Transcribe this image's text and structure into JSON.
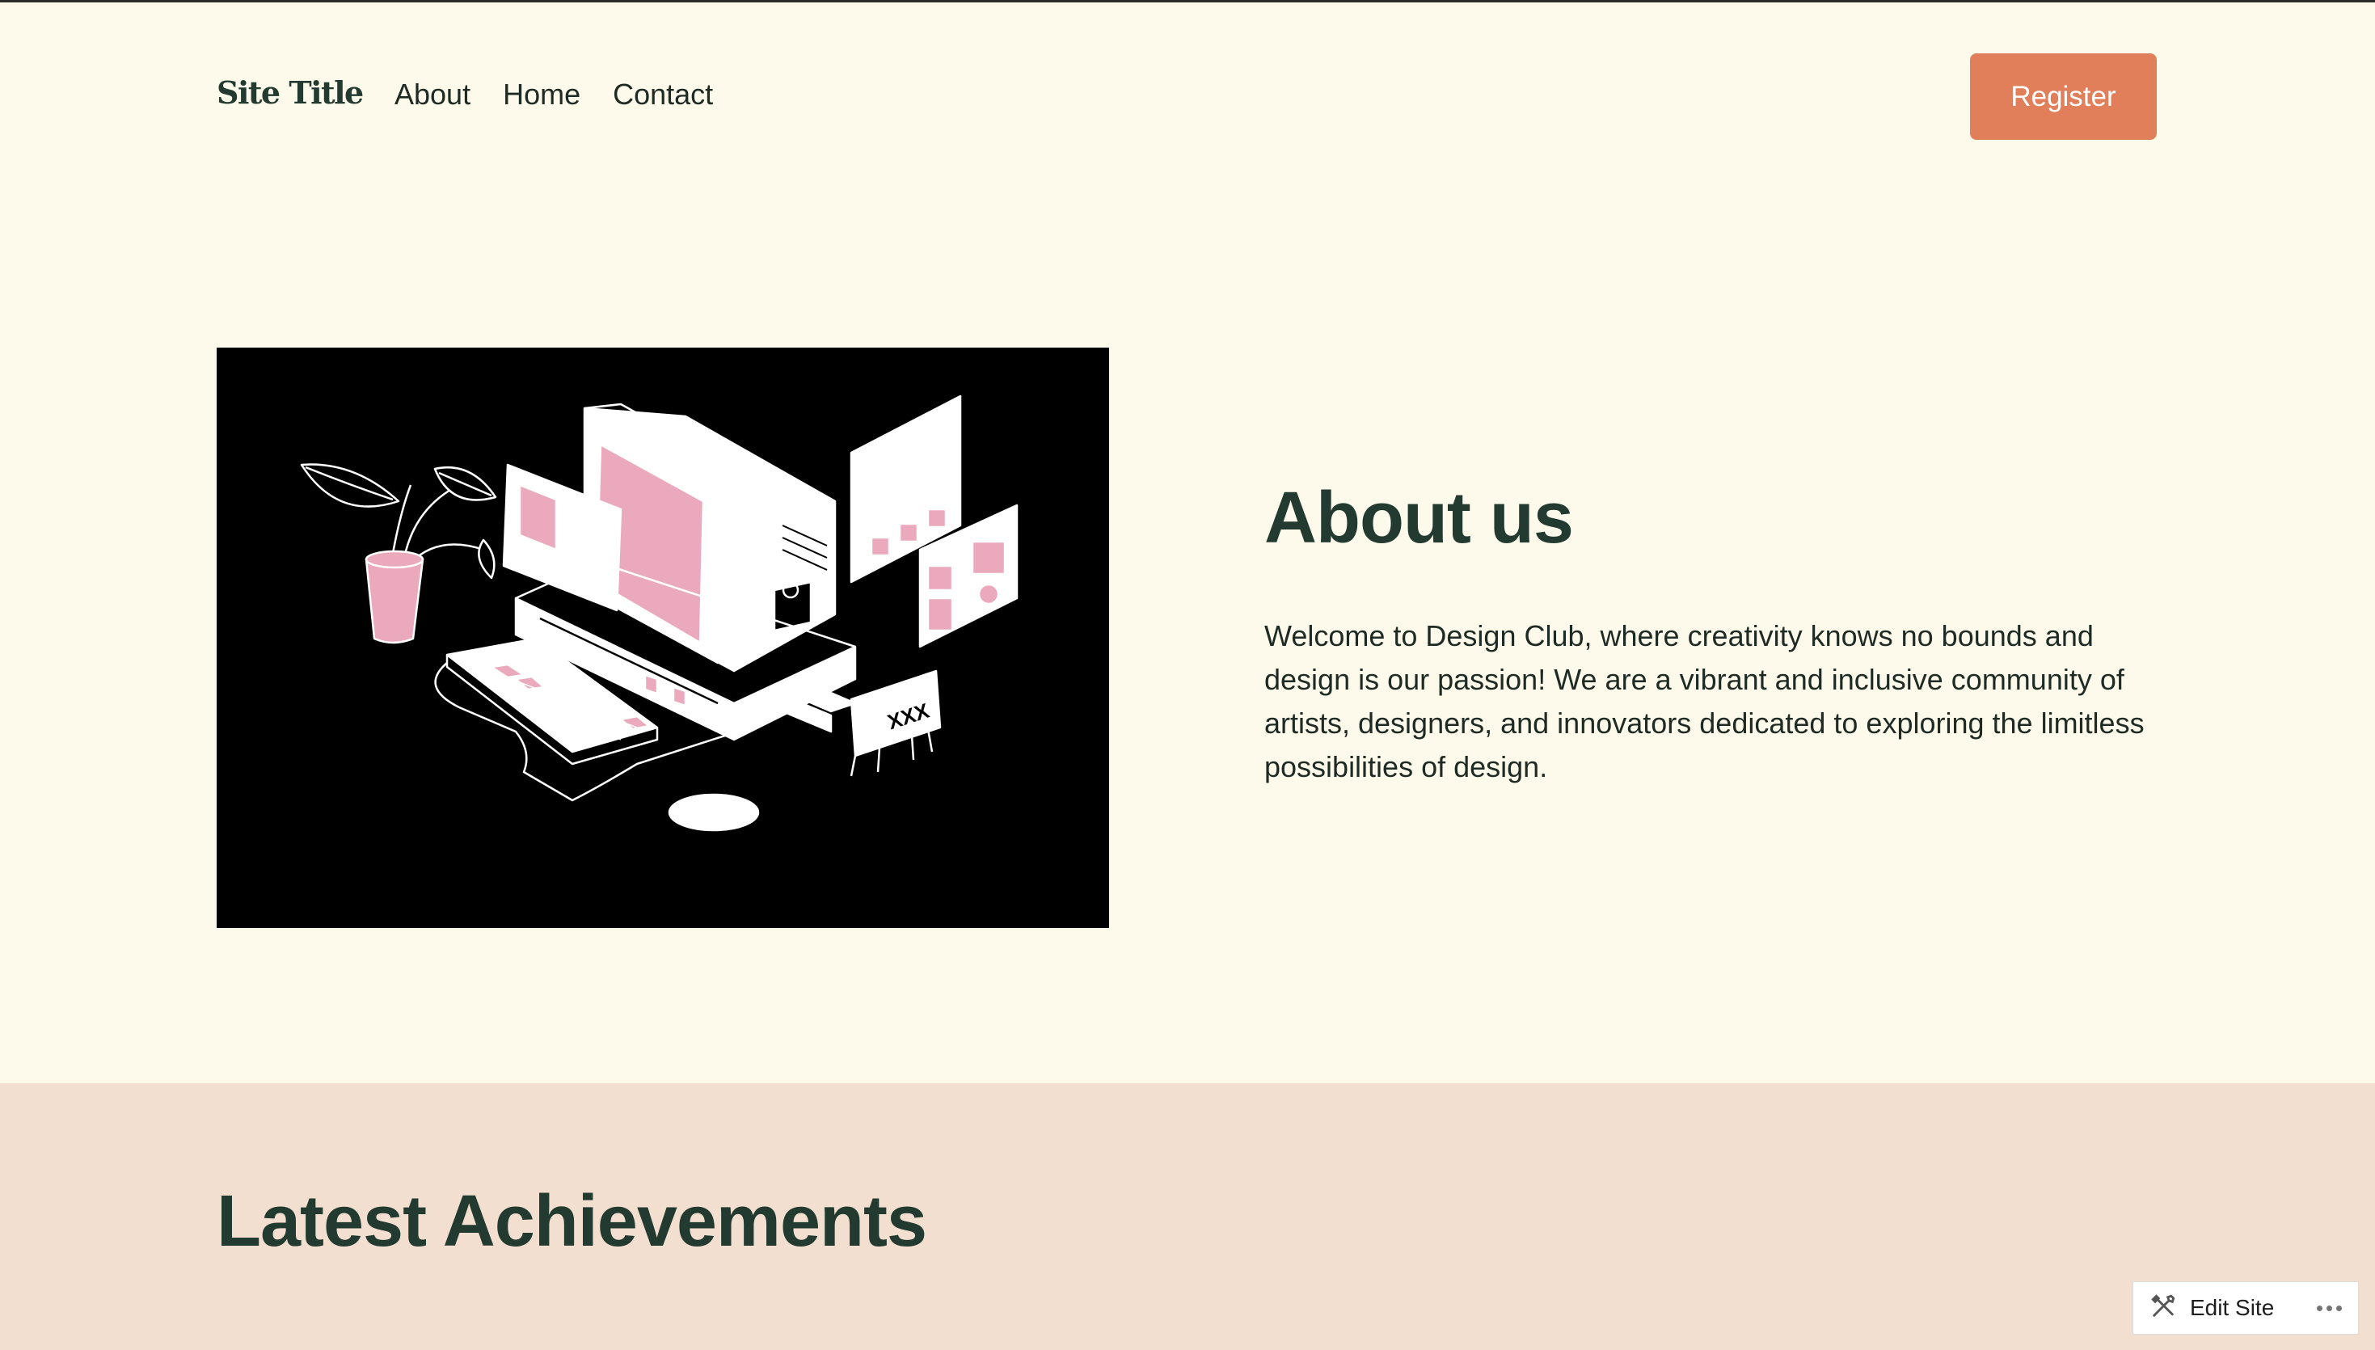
{
  "header": {
    "site_title": "Site Title",
    "nav": [
      "About",
      "Home",
      "Contact"
    ],
    "register_label": "Register"
  },
  "hero": {
    "illustration": "retro-computer-illustration",
    "about_heading": "About us",
    "about_text": "Welcome to Design Club, where creativity knows no bounds and design is our passion! We are a vibrant and inclusive community of artists, designers, and innovators dedicated to exploring the limitless possibilities of design.",
    "card_label": "XXX"
  },
  "achievements": {
    "heading": "Latest Achievements"
  },
  "edit_bar": {
    "label": "Edit Site",
    "icon": "tools-icon",
    "more_icon": "more-icon"
  },
  "colors": {
    "background": "#fefaeb",
    "accent": "#e07f5a",
    "band": "#f3dfcf",
    "heading": "#223a30",
    "pink": "#eaa9bc"
  }
}
